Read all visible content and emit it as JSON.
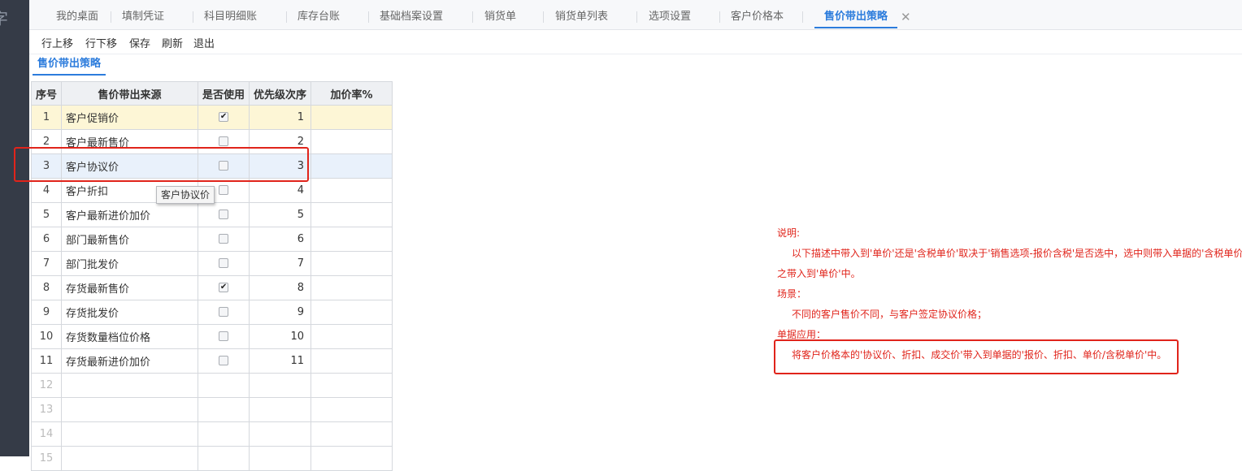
{
  "sidebar": {
    "glyph": "字"
  },
  "tabs": [
    {
      "label": "我的桌面"
    },
    {
      "label": "填制凭证"
    },
    {
      "label": "科目明细账"
    },
    {
      "label": "库存台账"
    },
    {
      "label": "基础档案设置"
    },
    {
      "label": "销货单"
    },
    {
      "label": "销货单列表"
    },
    {
      "label": "选项设置"
    },
    {
      "label": "客户价格本"
    },
    {
      "label": "售价带出策略",
      "active": true
    }
  ],
  "tab_close": "✕",
  "toolbar": {
    "move_up": "行上移",
    "move_down": "行下移",
    "save": "保存",
    "refresh": "刷新",
    "exit": "退出"
  },
  "subtab": {
    "label": "售价带出策略"
  },
  "grid": {
    "headers": [
      "序号",
      "售价带出来源",
      "是否使用",
      "优先级次序",
      "加价率%"
    ],
    "rows": [
      {
        "no": "1",
        "source": "客户促销价",
        "used": true,
        "priority": "1",
        "markup": ""
      },
      {
        "no": "2",
        "source": "客户最新售价",
        "used": false,
        "priority": "2",
        "markup": ""
      },
      {
        "no": "3",
        "source": "客户协议价",
        "used": false,
        "priority": "3",
        "markup": ""
      },
      {
        "no": "4",
        "source": "客户折扣",
        "used": false,
        "priority": "4",
        "markup": ""
      },
      {
        "no": "5",
        "source": "客户最新进价加价",
        "used": false,
        "priority": "5",
        "markup": ""
      },
      {
        "no": "6",
        "source": "部门最新售价",
        "used": false,
        "priority": "6",
        "markup": ""
      },
      {
        "no": "7",
        "source": "部门批发价",
        "used": false,
        "priority": "7",
        "markup": ""
      },
      {
        "no": "8",
        "source": "存货最新售价",
        "used": true,
        "priority": "8",
        "markup": ""
      },
      {
        "no": "9",
        "source": "存货批发价",
        "used": false,
        "priority": "9",
        "markup": ""
      },
      {
        "no": "10",
        "source": "存货数量档位价格",
        "used": false,
        "priority": "10",
        "markup": ""
      },
      {
        "no": "11",
        "source": "存货最新进价加价",
        "used": false,
        "priority": "11",
        "markup": ""
      }
    ],
    "empty_rows": [
      "12",
      "13",
      "14",
      "15"
    ]
  },
  "tooltip": {
    "text": "客户协议价"
  },
  "notes": {
    "title": "说明:",
    "line1": "以下描述中带入到'单价'还是'含税单价'取决于'销售选项-报价含税'是否选中，选中则带入单据的'含税单价'中，反",
    "line2": "之带入到'单价'中。",
    "scene_title": "场景：",
    "scene_text": "不同的客户售价不同，与客户签定协议价格；",
    "app_title": "单据应用：",
    "app_text": "将客户价格本的'协议价、折扣、成交价'带入到单据的'报价、折扣、单价/含税单价'中。"
  },
  "colors": {
    "accent": "#2c7cdc",
    "annotation_red": "#e0241b",
    "selected_row": "#fdf6d6",
    "hover_row": "#e9f1fb"
  }
}
